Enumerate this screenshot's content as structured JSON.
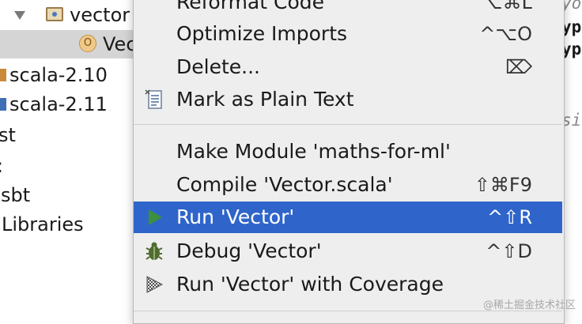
{
  "project_tree": {
    "items": [
      {
        "label": "vector"
      },
      {
        "label": "Vec",
        "icon_letter": "O"
      },
      {
        "label": "scala-2.10"
      },
      {
        "label": "scala-2.11"
      },
      {
        "label": "st"
      },
      {
        "label": ":"
      },
      {
        "label": "sbt"
      },
      {
        "label": "Libraries"
      }
    ]
  },
  "editor": {
    "lines": [
      {
        "text": "yo"
      },
      {
        "text": "yp"
      },
      {
        "text": "yp"
      },
      {
        "text": "si"
      }
    ]
  },
  "context_menu": {
    "items": [
      {
        "label": "Reformat Code",
        "shortcut": "⌥⌘L"
      },
      {
        "label": "Optimize Imports",
        "shortcut": "^⌥O"
      },
      {
        "label": "Delete...",
        "shortcut": "⌦"
      },
      {
        "label": "Mark as Plain Text",
        "shortcut": "",
        "icon": "document-icon"
      },
      {
        "label": "Make Module 'maths-for-ml'",
        "shortcut": ""
      },
      {
        "label": "Compile 'Vector.scala'",
        "shortcut": "⇧⌘F9"
      },
      {
        "label": "Run 'Vector'",
        "shortcut": "^⇧R",
        "icon": "run-icon"
      },
      {
        "label": "Debug 'Vector'",
        "shortcut": "^⇧D",
        "icon": "debug-icon"
      },
      {
        "label": "Run 'Vector' with Coverage",
        "shortcut": "",
        "icon": "coverage-icon"
      }
    ]
  },
  "watermark": "@稀土掘金技术社区",
  "colors": {
    "menu_background": "#eeeeee",
    "highlight": "#2f65ca",
    "tree_selected": "#d5d5d5"
  }
}
